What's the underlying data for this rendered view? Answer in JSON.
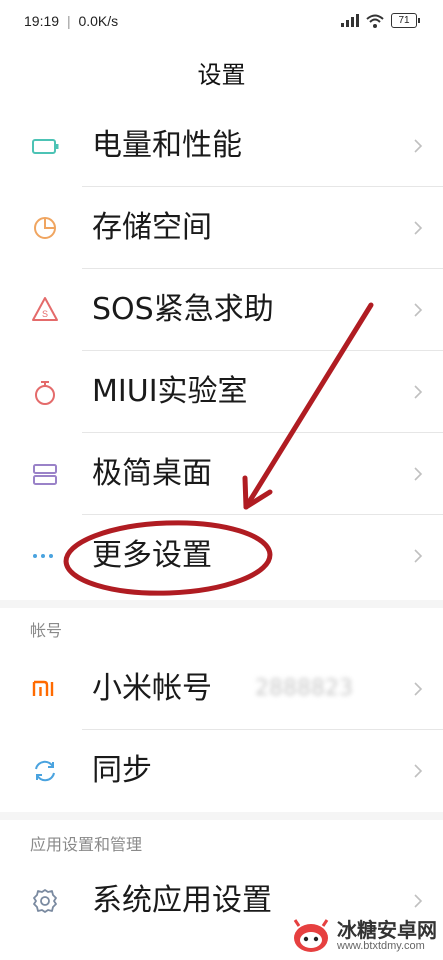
{
  "status": {
    "time": "19:19",
    "network_speed": "0.0K/s",
    "battery_level": "71"
  },
  "header": {
    "title": "设置"
  },
  "rows": [
    {
      "label": "电量和性能",
      "icon": "battery-icon"
    },
    {
      "label": "存储空间",
      "icon": "storage-pie-icon"
    },
    {
      "label": "SOS紧急求助",
      "icon": "sos-warning-icon"
    },
    {
      "label": "MIUI实验室",
      "icon": "lab-flask-icon"
    },
    {
      "label": "极简桌面",
      "icon": "simple-desktop-icon"
    },
    {
      "label": "更多设置",
      "icon": "more-dots-icon"
    }
  ],
  "sections": {
    "account": {
      "header": "帐号",
      "items": [
        {
          "label": "小米帐号",
          "value": "2888823",
          "icon": "mi-logo-icon"
        },
        {
          "label": "同步",
          "icon": "sync-icon"
        }
      ]
    },
    "apps": {
      "header": "应用设置和管理",
      "items": [
        {
          "label": "系统应用设置",
          "icon": "gear-icon"
        }
      ]
    }
  },
  "watermark": {
    "name": "冰糖安卓网",
    "url": "www.btxtdmy.com"
  },
  "colors": {
    "annotation": "#b01c22",
    "icon_teal": "#4cc3b5",
    "icon_orange": "#f0a560",
    "icon_red": "#e46b6b",
    "icon_purple": "#9a82c8",
    "icon_blue": "#4aa3df",
    "icon_mi": "#ff6a00"
  }
}
